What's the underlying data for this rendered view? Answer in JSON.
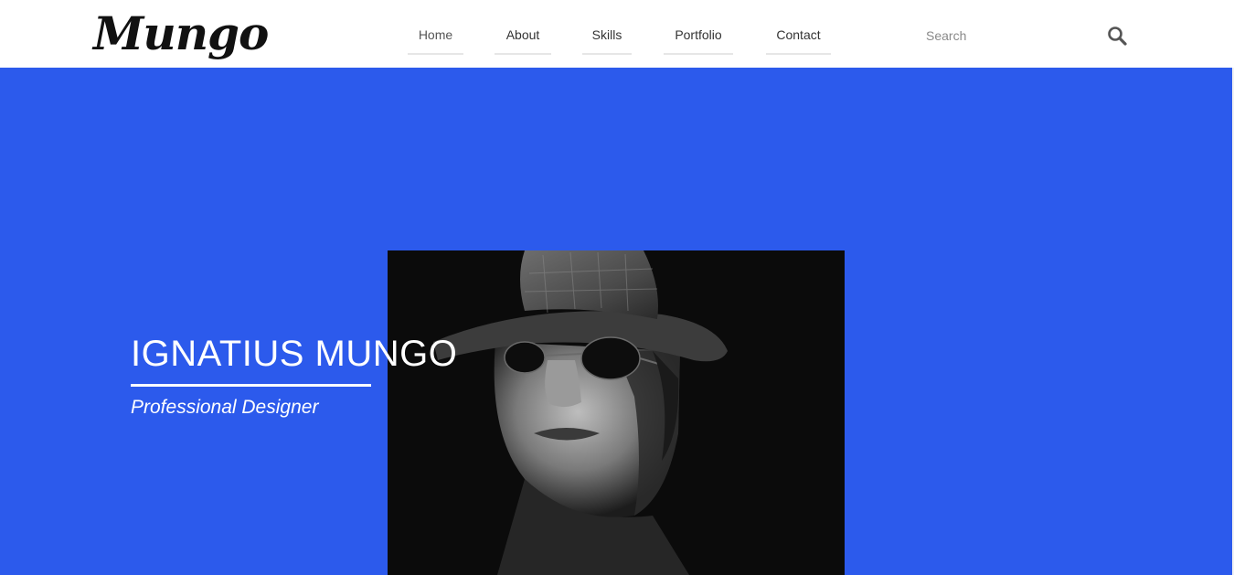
{
  "brand": {
    "logo_text": "Mungo"
  },
  "nav": {
    "items": [
      {
        "label": "Home"
      },
      {
        "label": "About"
      },
      {
        "label": "Skills"
      },
      {
        "label": "Portfolio"
      },
      {
        "label": "Contact"
      }
    ]
  },
  "search": {
    "placeholder": "Search",
    "value": "",
    "icon": "search-icon"
  },
  "hero": {
    "name": "IGNATIUS MUNGO",
    "subtitle": "Professional Designer",
    "background_color": "#2c5aec",
    "photo_icon": "portrait-photo"
  }
}
